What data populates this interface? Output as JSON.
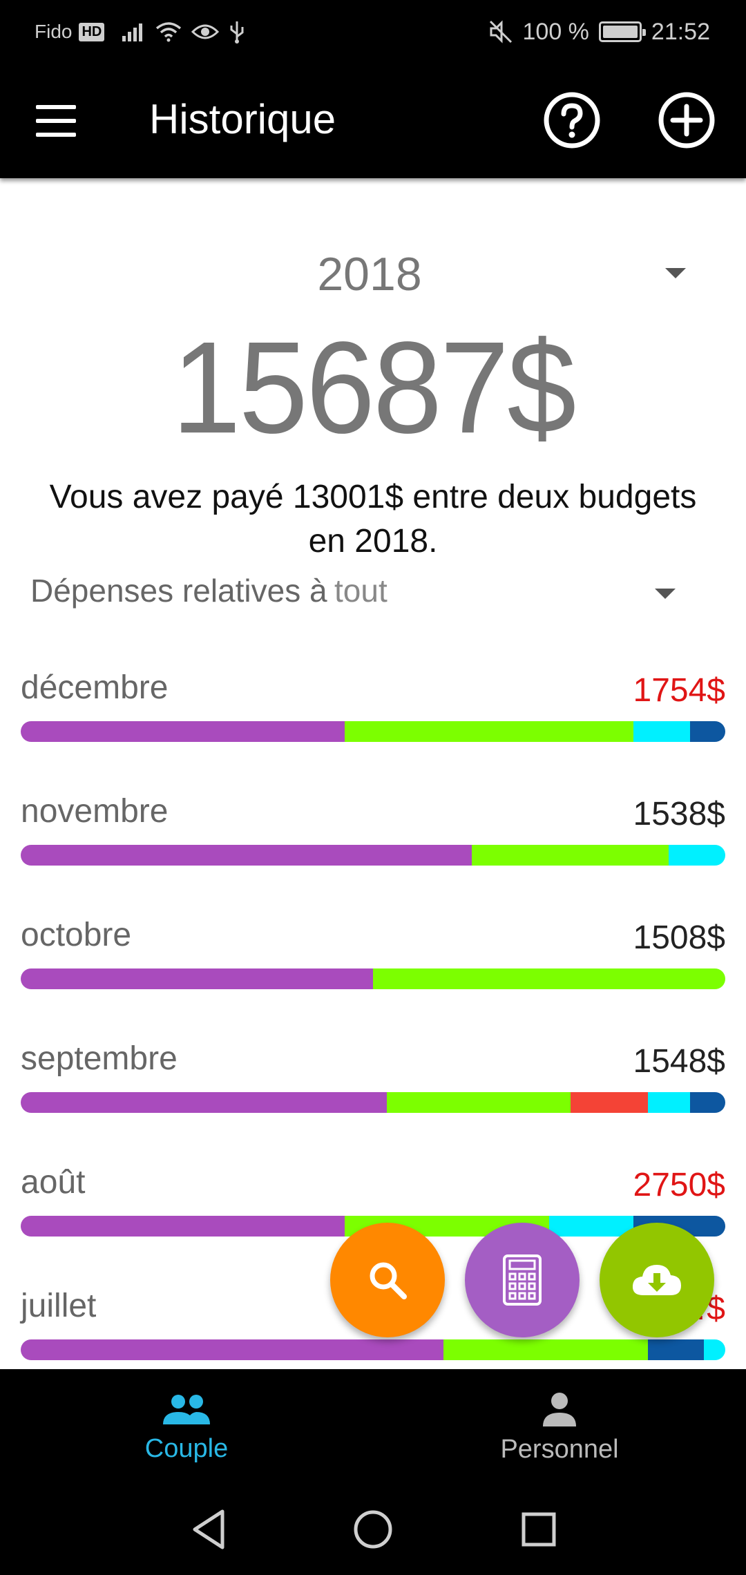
{
  "status_bar": {
    "carrier": "Fido",
    "hd_badge": "HD",
    "battery": "100 %",
    "time": "21:52"
  },
  "app_bar": {
    "title": "Historique"
  },
  "summary": {
    "year": "2018",
    "total": "15687$",
    "paid_sentence": "Vous avez payé 13001$ entre deux budgets en 2018.",
    "filter_label": "Dépenses relatives à",
    "filter_value": "tout"
  },
  "colors": {
    "purple": "#a94bbd",
    "green": "#7cff00",
    "cyan": "#00f0ff",
    "blue": "#0d57a0",
    "red": "#f44336",
    "over_budget_text": "#e01515",
    "normal_text": "#222222"
  },
  "months": [
    {
      "name": "décembre",
      "amount": "1754$",
      "over": true,
      "segments": [
        {
          "color": "#a94bbd",
          "fraction": 0.46
        },
        {
          "color": "#7cff00",
          "fraction": 0.41
        },
        {
          "color": "#00f0ff",
          "fraction": 0.08
        },
        {
          "color": "#0d57a0",
          "fraction": 0.05
        }
      ]
    },
    {
      "name": "novembre",
      "amount": "1538$",
      "over": false,
      "segments": [
        {
          "color": "#a94bbd",
          "fraction": 0.64
        },
        {
          "color": "#7cff00",
          "fraction": 0.28
        },
        {
          "color": "#00f0ff",
          "fraction": 0.08
        }
      ]
    },
    {
      "name": "octobre",
      "amount": "1508$",
      "over": false,
      "segments": [
        {
          "color": "#a94bbd",
          "fraction": 0.5
        },
        {
          "color": "#7cff00",
          "fraction": 0.5
        }
      ]
    },
    {
      "name": "septembre",
      "amount": "1548$",
      "over": false,
      "segments": [
        {
          "color": "#a94bbd",
          "fraction": 0.52
        },
        {
          "color": "#7cff00",
          "fraction": 0.26
        },
        {
          "color": "#f44336",
          "fraction": 0.11
        },
        {
          "color": "#00f0ff",
          "fraction": 0.06
        },
        {
          "color": "#0d57a0",
          "fraction": 0.05
        }
      ]
    },
    {
      "name": "août",
      "amount": "2750$",
      "over": true,
      "segments": [
        {
          "color": "#a94bbd",
          "fraction": 0.46
        },
        {
          "color": "#7cff00",
          "fraction": 0.29
        },
        {
          "color": "#00f0ff",
          "fraction": 0.12
        },
        {
          "color": "#0d57a0",
          "fraction": 0.13
        }
      ]
    },
    {
      "name": "juillet",
      "amount": "…$",
      "over": true,
      "segments": [
        {
          "color": "#a94bbd",
          "fraction": 0.6
        },
        {
          "color": "#7cff00",
          "fraction": 0.29
        },
        {
          "color": "#0d57a0",
          "fraction": 0.08
        },
        {
          "color": "#00f0ff",
          "fraction": 0.03
        }
      ]
    }
  ],
  "fabs": {
    "search": "search-icon",
    "calculator": "calculator-icon",
    "download": "cloud-download-icon"
  },
  "bottom_nav": {
    "couple_label": "Couple",
    "personnel_label": "Personnel"
  }
}
